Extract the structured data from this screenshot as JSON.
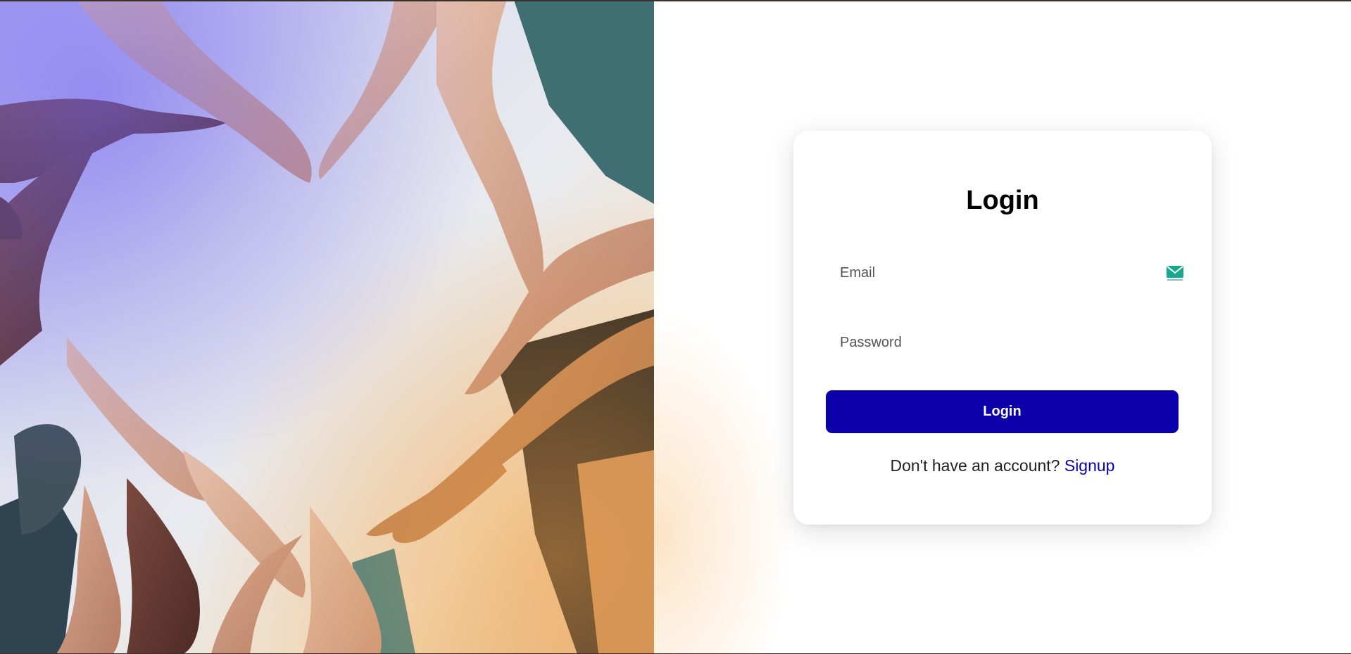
{
  "login_card": {
    "title": "Login",
    "email_placeholder": "Email",
    "password_placeholder": "Password",
    "submit_label": "Login",
    "signup_prompt": "Don't have an account?",
    "signup_link": "Signup",
    "mail_icon": "mail-icon"
  },
  "colors": {
    "primary": "#0c00aa",
    "mail_icon": "#17a98f"
  },
  "hero": {
    "image": "hands-forming-heart-photo"
  }
}
